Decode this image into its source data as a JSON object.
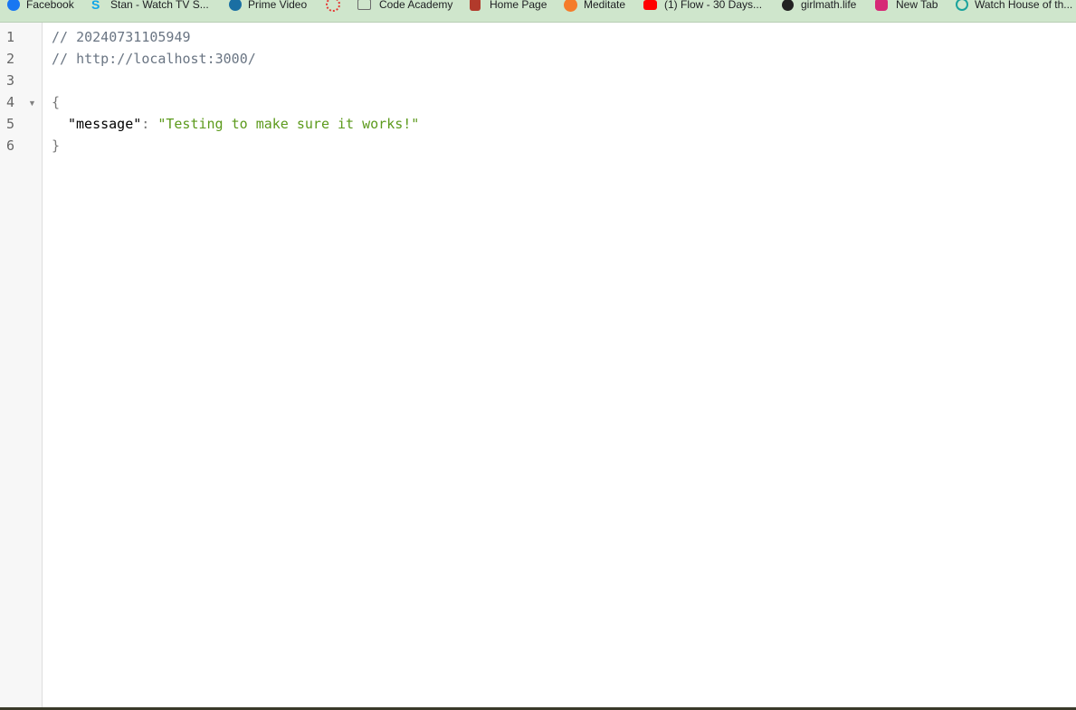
{
  "bookmarks": [
    {
      "label": "Facebook",
      "icon": "facebook-icon",
      "color": "#1877f2"
    },
    {
      "label": "Stan - Watch TV S...",
      "icon": "stan-icon",
      "color": "#0ea5e9"
    },
    {
      "label": "Prime Video",
      "icon": "prime-video-icon",
      "color": "#1a6fa3"
    },
    {
      "label": "",
      "icon": "loading-spinner-icon",
      "color": "#e53935"
    },
    {
      "label": "Code Academy",
      "icon": "folder-icon",
      "color": "#6b6b6b"
    },
    {
      "label": "Home Page",
      "icon": "home-page-avatar-icon",
      "color": "#b23a2b"
    },
    {
      "label": "Meditate",
      "icon": "meditate-icon",
      "color": "#f57c2a"
    },
    {
      "label": "(1) Flow - 30 Days...",
      "icon": "youtube-icon",
      "color": "#ff0000"
    },
    {
      "label": "girlmath.life",
      "icon": "globe-icon",
      "color": "#222222"
    },
    {
      "label": "New Tab",
      "icon": "instagram-icon",
      "color": "#d62976"
    },
    {
      "label": "Watch House of th...",
      "icon": "streaming-icon",
      "color": "#1ba39c"
    }
  ],
  "editor": {
    "line_numbers": [
      "1",
      "2",
      "3",
      "4",
      "5",
      "6"
    ],
    "comment_timestamp": "// 20240731105949",
    "comment_url": "// http://localhost:3000/",
    "open_brace": "{",
    "close_brace": "}",
    "json_key": "\"message\"",
    "colon": ": ",
    "json_value": "\"Testing to make sure it works!\"",
    "fold_marker": "▼"
  }
}
